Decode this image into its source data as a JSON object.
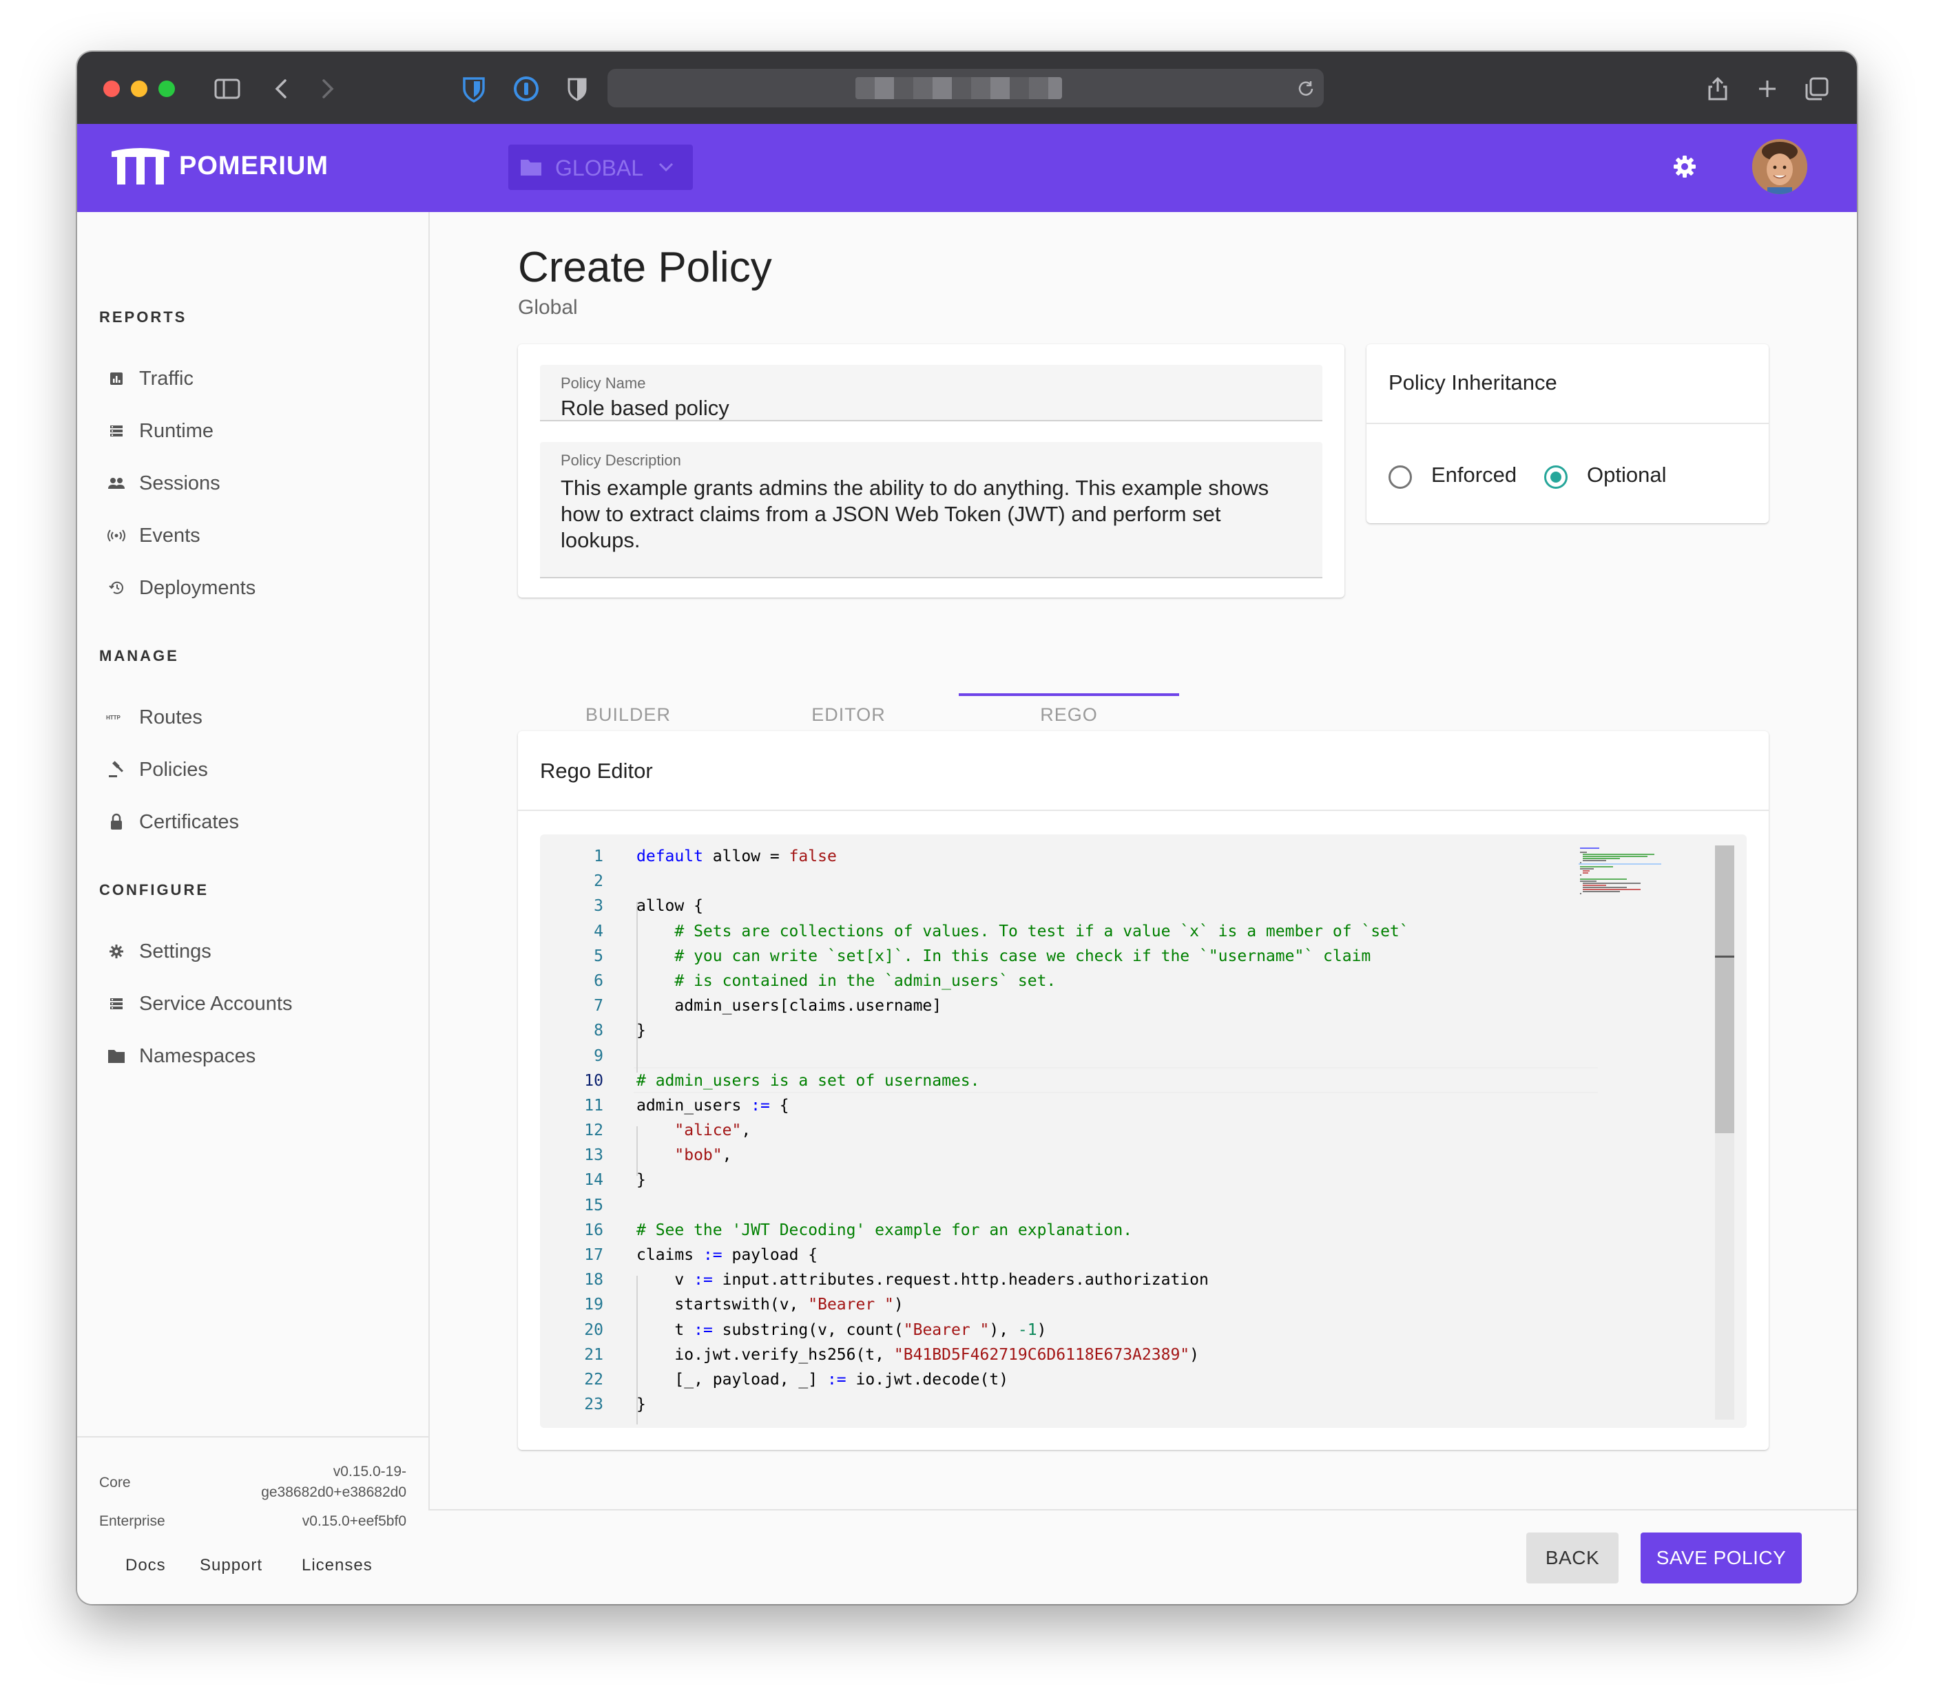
{
  "app": {
    "name": "POMERIUM",
    "namespace": "GLOBAL"
  },
  "sidebar": {
    "sections": [
      {
        "title": "REPORTS",
        "items": [
          {
            "label": "Traffic",
            "icon": "bar-chart-icon"
          },
          {
            "label": "Runtime",
            "icon": "storage-icon"
          },
          {
            "label": "Sessions",
            "icon": "people-icon"
          },
          {
            "label": "Events",
            "icon": "radio-waves-icon"
          },
          {
            "label": "Deployments",
            "icon": "history-icon"
          }
        ]
      },
      {
        "title": "MANAGE",
        "items": [
          {
            "label": "Routes",
            "icon": "http-icon"
          },
          {
            "label": "Policies",
            "icon": "gavel-icon"
          },
          {
            "label": "Certificates",
            "icon": "lock-icon"
          }
        ]
      },
      {
        "title": "CONFIGURE",
        "items": [
          {
            "label": "Settings",
            "icon": "gear-icon"
          },
          {
            "label": "Service Accounts",
            "icon": "storage-icon"
          },
          {
            "label": "Namespaces",
            "icon": "folder-icon"
          }
        ]
      }
    ],
    "footer": {
      "core_label": "Core",
      "core_version_line1": "v0.15.0-19-",
      "core_version_line2": "ge38682d0+e38682d0",
      "enterprise_label": "Enterprise",
      "enterprise_version": "v0.15.0+eef5bf0",
      "links": [
        "Docs",
        "Support",
        "Licenses"
      ]
    }
  },
  "page": {
    "title": "Create Policy",
    "subtitle": "Global"
  },
  "form": {
    "name_label": "Policy Name",
    "name_value": "Role based policy",
    "description_label": "Policy Description",
    "description_value": "This example grants admins the ability to do anything. This example shows how to extract claims from a JSON Web Token (JWT) and perform set lookups."
  },
  "inheritance": {
    "title": "Policy Inheritance",
    "options": [
      "Enforced",
      "Optional"
    ],
    "selected": "Optional"
  },
  "tabs": {
    "items": [
      "BUILDER",
      "EDITOR",
      "REGO"
    ],
    "active": "REGO"
  },
  "editor": {
    "title": "Rego Editor",
    "active_line": 10,
    "lines": [
      "default allow = false",
      "",
      "allow {",
      "    # Sets are collections of values. To test if a value `x` is a member of `set`",
      "    # you can write `set[x]`. In this case we check if the `\"username\"` claim",
      "    # is contained in the `admin_users` set.",
      "    admin_users[claims.username]",
      "}",
      "",
      "# admin_users is a set of usernames.",
      "admin_users := {",
      "    \"alice\",",
      "    \"bob\",",
      "}",
      "",
      "# See the 'JWT Decoding' example for an explanation.",
      "claims := payload {",
      "    v := input.attributes.request.http.headers.authorization",
      "    startswith(v, \"Bearer \")",
      "    t := substring(v, count(\"Bearer \"), -1)",
      "    io.jwt.verify_hs256(t, \"B41BD5F462719C6D6118E673A2389\")",
      "    [_, payload, _] := io.jwt.decode(t)",
      "}"
    ]
  },
  "actions": {
    "back": "BACK",
    "save": "SAVE POLICY"
  },
  "colors": {
    "brand": "#6e43e8",
    "radio_selected": "#26a69a"
  }
}
